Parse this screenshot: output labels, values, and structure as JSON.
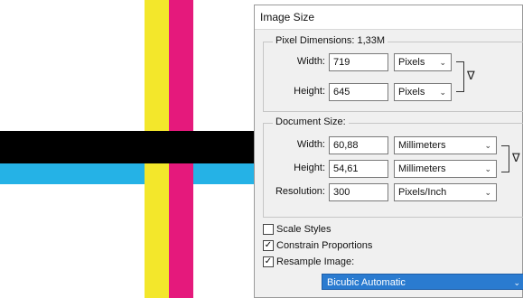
{
  "colors": {
    "yellow": "#f3e72b",
    "magenta": "#e5197c",
    "black": "#000000",
    "cyan": "#25b2e6",
    "highlight": "#2a7bd0"
  },
  "dialog": {
    "title": "Image Size",
    "pixel_dimensions": {
      "legend": "Pixel Dimensions:  1,33M",
      "width_label": "Width:",
      "width_value": "719",
      "width_unit": "Pixels",
      "height_label": "Height:",
      "height_value": "645",
      "height_unit": "Pixels"
    },
    "document_size": {
      "legend": "Document Size:",
      "width_label": "Width:",
      "width_value": "60,88",
      "width_unit": "Millimeters",
      "height_label": "Height:",
      "height_value": "54,61",
      "height_unit": "Millimeters",
      "resolution_label": "Resolution:",
      "resolution_value": "300",
      "resolution_unit": "Pixels/Inch"
    },
    "options": {
      "scale_styles": {
        "label": "Scale Styles",
        "checked": false
      },
      "constrain_proportions": {
        "label": "Constrain Proportions",
        "checked": true
      },
      "resample_image": {
        "label": "Resample Image:",
        "checked": true
      },
      "resample_method": "Bicubic Automatic"
    },
    "icons": {
      "chain": "chain-link-icon",
      "chevron": "chevron-down-icon"
    }
  }
}
